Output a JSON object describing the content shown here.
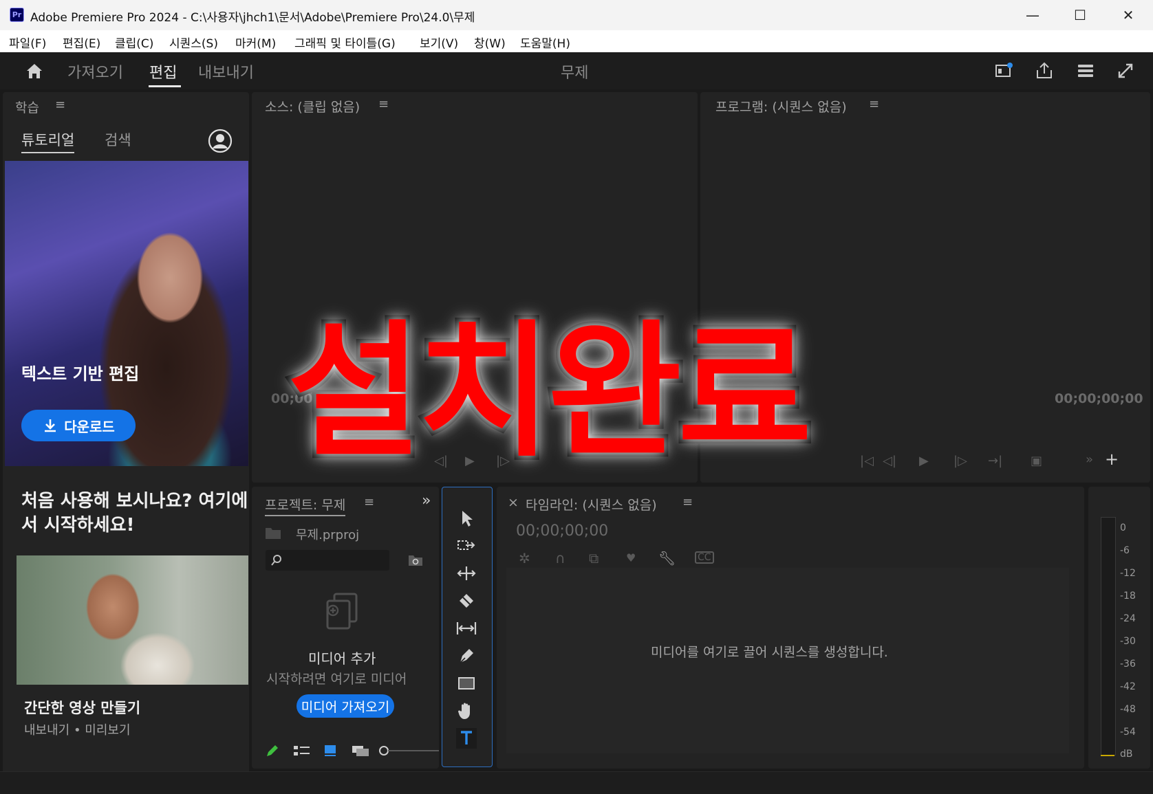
{
  "window": {
    "app_badge": "Pr",
    "title": "Adobe Premiere Pro 2024 - C:\\사용자\\jhch1\\문서\\Adobe\\Premiere Pro\\24.0\\무제",
    "minimize": "—",
    "maximize": "☐",
    "close": "✕"
  },
  "menu": [
    "파일(F)",
    "편집(E)",
    "클립(C)",
    "시퀀스(S)",
    "마커(M)",
    "그래픽 및 타이틀(G)",
    "보기(V)",
    "창(W)",
    "도움말(H)"
  ],
  "header": {
    "tabs": [
      "가져오기",
      "편집",
      "내보내기"
    ],
    "active_tab": "편집",
    "project_title": "무제"
  },
  "learn": {
    "title": "학습",
    "menu": "≡",
    "tabs": [
      "튜토리얼",
      "검색"
    ],
    "card1_title": "텍스트 기반 편집",
    "download_label": "다운로드",
    "intro": "처음 사용해 보시나요? 여기에서 시작하세요!",
    "card2_title": "간단한 영상 만들기",
    "card2_tags": "내보내기 • 미리보기"
  },
  "source": {
    "title": "소스: (클립 없음)",
    "menu": "≡",
    "timecode": "00;00;00;00"
  },
  "program": {
    "title": "프로그램: (시퀀스 없음)",
    "menu": "≡",
    "timecode": "00;00;00;00"
  },
  "project": {
    "title": "프로젝트: 무제",
    "menu": "≡",
    "more": "»",
    "filename": "무제.prproj",
    "search_placeholder": "",
    "empty_title": "미디어 추가",
    "empty_desc": "시작하려면 여기로 미디어",
    "import_button": "미디어 가져오기"
  },
  "timeline": {
    "close": "×",
    "title": "타임라인: (시퀀스 없음)",
    "menu": "≡",
    "timecode": "00;00;00;00",
    "empty_message": "미디어를 여기로 끌어 시퀀스를 생성합니다."
  },
  "meter": {
    "labels": [
      "0",
      "-6",
      "-12",
      "-18",
      "-24",
      "-30",
      "-36",
      "-42",
      "-48",
      "-54",
      "dB"
    ]
  },
  "overlay": {
    "text": "설치완료"
  },
  "colors": {
    "accent_blue": "#1473e6",
    "overlay_red": "#ff0000",
    "panel_bg": "#232323",
    "app_bg": "#1a1a1a"
  }
}
